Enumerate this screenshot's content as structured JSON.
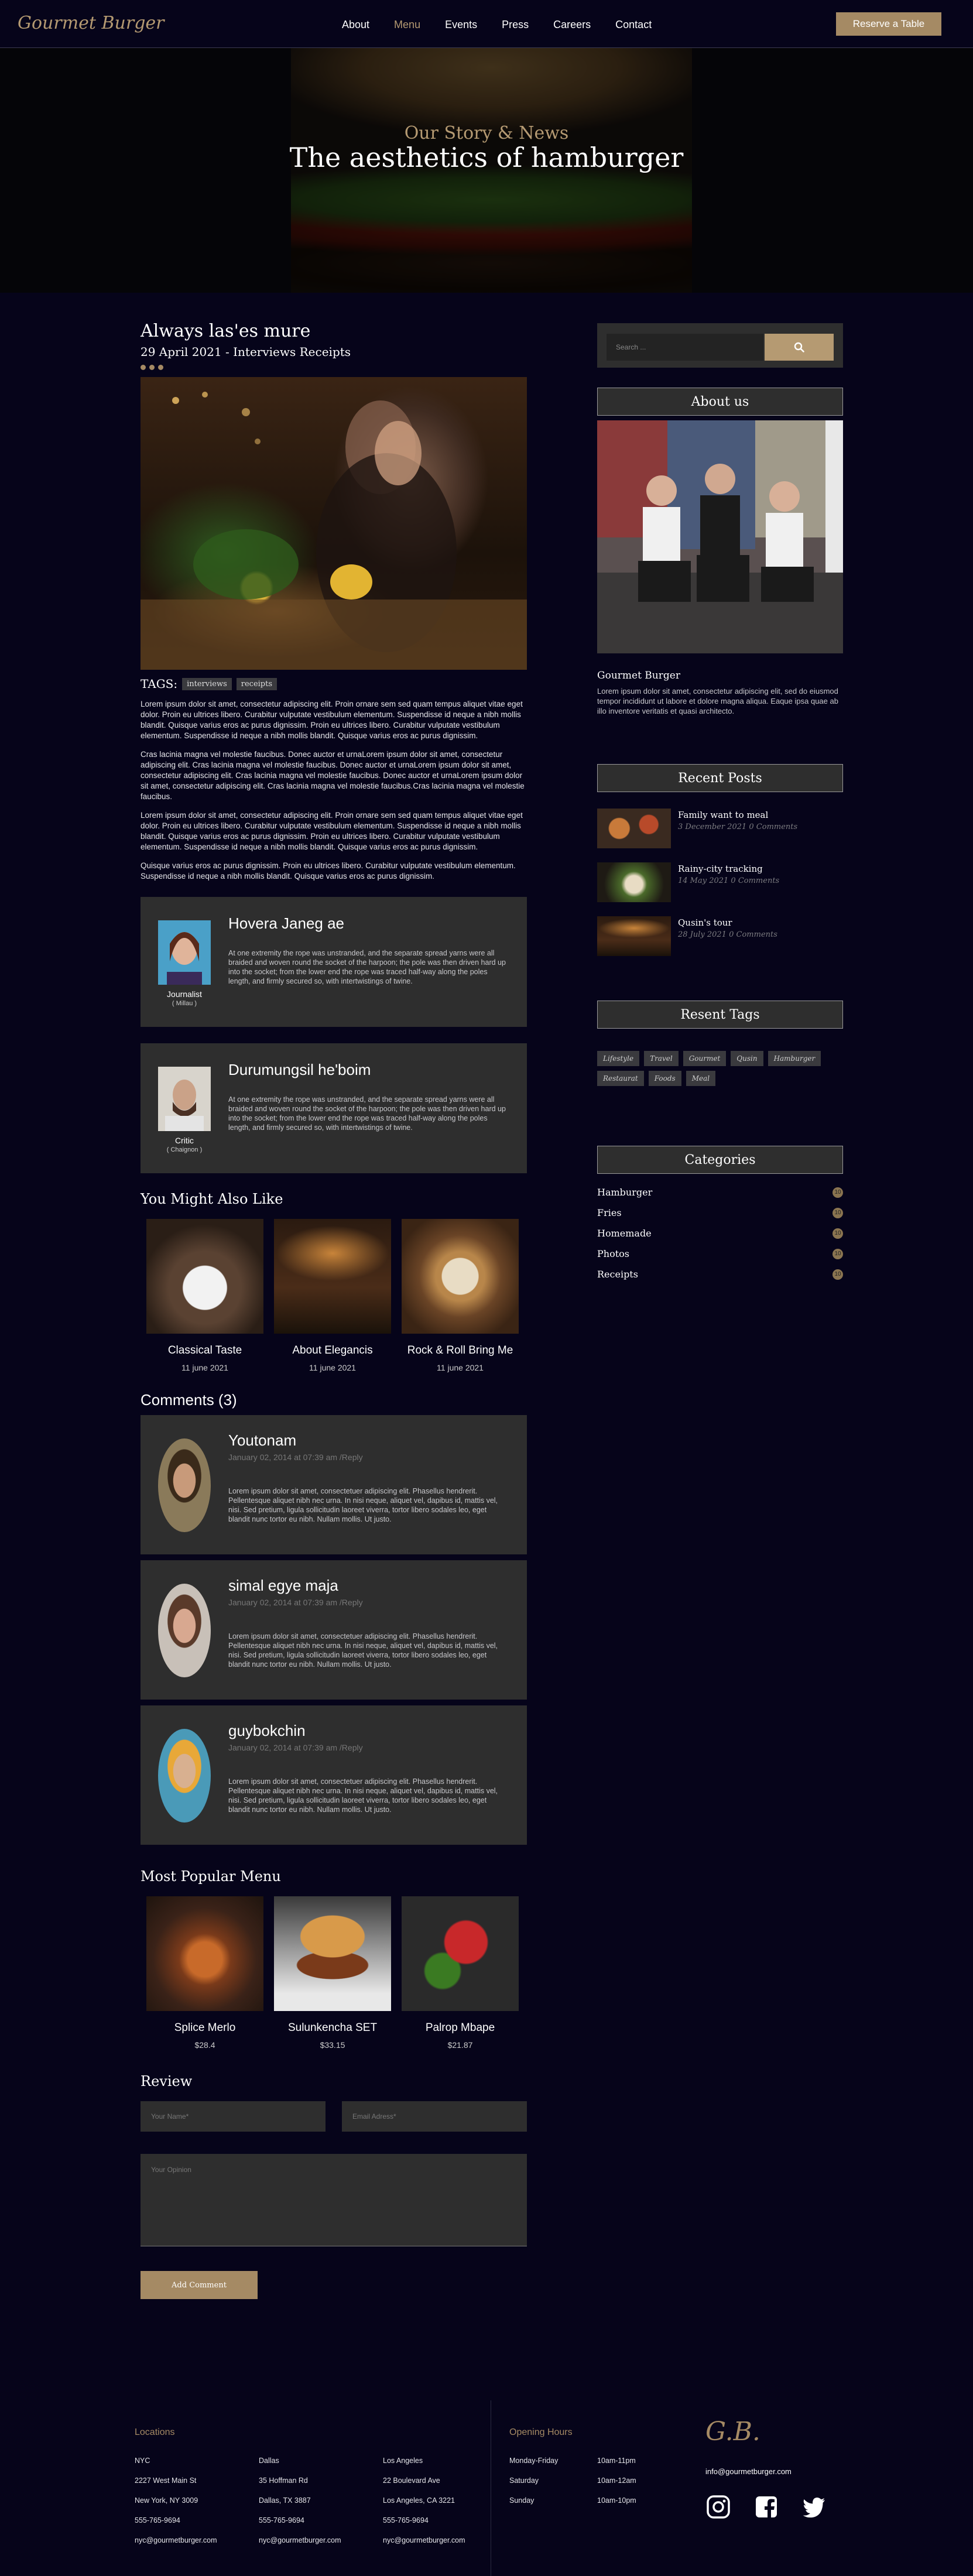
{
  "header": {
    "logo": "Gourmet Burger",
    "nav": [
      "About",
      "Menu",
      "Events",
      "Press",
      "Careers",
      "Contact"
    ],
    "active_nav": "Menu",
    "reserve_label": "Reserve a Table"
  },
  "hero": {
    "subtitle": "Our Story & News",
    "title": "The aesthetics of hamburger"
  },
  "post": {
    "title": "Always las'es mure",
    "meta": "29 April 2021 - Interviews Receipts",
    "tags_label": "TAGS:",
    "tags": [
      "interviews",
      "receipts"
    ],
    "paragraphs": [
      "Lorem ipsum dolor sit amet, consectetur adipiscing elit. Proin ornare sem sed quam tempus aliquet vitae eget dolor. Proin eu ultrices libero. Curabitur vulputate vestibulum elementum. Suspendisse id neque a nibh mollis blandit. Quisque varius eros ac purus dignissim. Proin eu ultrices libero. Curabitur vulputate vestibulum elementum. Suspendisse id neque a nibh mollis blandit. Quisque varius eros ac purus dignissim.",
      "Cras lacinia magna vel molestie faucibus. Donec auctor et urnaLorem ipsum dolor sit amet, consectetur adipiscing elit. Cras lacinia magna vel molestie faucibus. Donec auctor et urnaLorem ipsum dolor sit amet, consectetur adipiscing elit. Cras lacinia magna vel molestie faucibus. Donec auctor et urnaLorem ipsum dolor sit amet, consectetur adipiscing elit. Cras lacinia magna vel molestie faucibus.Cras lacinia magna vel molestie faucibus.",
      "Lorem ipsum dolor sit amet, consectetur adipiscing elit. Proin ornare sem sed quam tempus aliquet vitae eget dolor. Proin eu ultrices libero. Curabitur vulputate vestibulum elementum. Suspendisse id neque a nibh mollis blandit. Quisque varius eros ac purus dignissim. Proin eu ultrices libero. Curabitur vulputate vestibulum elementum. Suspendisse id neque a nibh mollis blandit. Quisque varius eros ac purus dignissim.",
      "Quisque varius eros ac purus dignissim. Proin eu ultrices libero. Curabitur vulputate vestibulum elementum. Suspendisse id neque a nibh mollis blandit. Quisque varius eros ac purus dignissim."
    ]
  },
  "authors": [
    {
      "name": "Hovera Janeg ae",
      "role": "Journalist",
      "location": "( Millau )",
      "bio": "At one extremity the rope was unstranded, and the separate spread yarns were all braided and woven round the socket of the harpoon; the pole was then driven hard up into the socket; from the lower end the rope was traced half-way along the poles length, and firmly secured so, with intertwistings of twine."
    },
    {
      "name": "Durumungsil he'boim",
      "role": "Critic",
      "location": "( Chaignon )",
      "bio": "At one extremity the rope was unstranded, and the separate spread yarns were all braided and woven round the socket of the harpoon; the pole was then driven hard up into the socket; from the lower end the rope was traced half-way along the poles length, and firmly secured so, with intertwistings of twine."
    }
  ],
  "also_like": {
    "heading": "You Might Also Like",
    "items": [
      {
        "name": "Classical Taste",
        "date": "11 june 2021"
      },
      {
        "name": "About Elegancis",
        "date": "11 june 2021"
      },
      {
        "name": "Rock & Roll Bring Me",
        "date": "11 june 2021"
      }
    ]
  },
  "comments": {
    "heading": "Comments (3)",
    "items": [
      {
        "name": "Youtonam",
        "date": "January 02, 2014 at 07:39 am /Reply",
        "text": "Lorem ipsum dolor sit amet, consectetuer adipiscing elit. Phasellus hendrerit. Pellentesque aliquet nibh nec urna. In nisi neque, aliquet vel, dapibus id, mattis vel, nisi. Sed pretium, ligula sollicitudin laoreet viverra, tortor libero sodales leo, eget blandit nunc tortor eu nibh. Nullam mollis. Ut justo."
      },
      {
        "name": "simal egye maja",
        "date": "January 02, 2014 at 07:39 am /Reply",
        "text": "Lorem ipsum dolor sit amet, consectetuer adipiscing elit. Phasellus hendrerit. Pellentesque aliquet nibh nec urna. In nisi neque, aliquet vel, dapibus id, mattis vel, nisi. Sed pretium, ligula sollicitudin laoreet viverra, tortor libero sodales leo, eget blandit nunc tortor eu nibh. Nullam mollis. Ut justo."
      },
      {
        "name": "guybokchin",
        "date": "January 02, 2014 at 07:39 am /Reply",
        "text": "Lorem ipsum dolor sit amet, consectetuer adipiscing elit. Phasellus hendrerit. Pellentesque aliquet nibh nec urna. In nisi neque, aliquet vel, dapibus id, mattis vel, nisi. Sed pretium, ligula sollicitudin laoreet viverra, tortor libero sodales leo, eget blandit nunc tortor eu nibh. Nullam mollis. Ut justo."
      }
    ]
  },
  "popular": {
    "heading": "Most Popular Menu",
    "items": [
      {
        "name": "Splice Merlo",
        "price": "$28.4"
      },
      {
        "name": "Sulunkencha SET",
        "price": "$33.15"
      },
      {
        "name": "Palrop Mbape",
        "price": "$21.87"
      }
    ]
  },
  "review": {
    "heading": "Review",
    "name_placeholder": "Your Name*",
    "email_placeholder": "Email Adress*",
    "opinion_placeholder": "Your Opinion",
    "submit_label": "Add Comment"
  },
  "sidebar": {
    "search_placeholder": "Search ...",
    "about_heading": "About us",
    "about_name": "Gourmet Burger",
    "about_text": "Lorem ipsum dolor sit amet, consectetur adipiscing elit, sed do eiusmod tempor incididunt ut labore et dolore magna aliqua. Eaque ipsa quae ab illo inventore veritatis et quasi architecto.",
    "recent_heading": "Recent Posts",
    "recent": [
      {
        "title": "Family want to meal",
        "meta": "3 December 2021 0 Comments"
      },
      {
        "title": "Rainy-city tracking",
        "meta": "14 May 2021 0 Comments"
      },
      {
        "title": "Qusin's tour",
        "meta": "28 July 2021 0 Comments"
      }
    ],
    "tags_heading": "Resent Tags",
    "tags": [
      "Lifestyle",
      "Travel",
      "Gourmet",
      "Qusin",
      "Hamburger",
      "Restaurat",
      "Foods",
      "Meal"
    ],
    "categories_heading": "Categories",
    "categories": [
      {
        "name": "Hamburger",
        "count": "10"
      },
      {
        "name": "Fries",
        "count": "10"
      },
      {
        "name": "Homemade",
        "count": "10"
      },
      {
        "name": "Photos",
        "count": "10"
      },
      {
        "name": "Receipts",
        "count": "10"
      }
    ]
  },
  "footer": {
    "locations_heading": "Locations",
    "locations": [
      {
        "city": "NYC",
        "address": "2227 West Main St",
        "region": "New York, NY 3009",
        "phone": "555-765-9694",
        "email": "nyc@gourmetburger.com"
      },
      {
        "city": "Dallas",
        "address": "35 Hoffman Rd",
        "region": "Dallas, TX 3887",
        "phone": "555-765-9694",
        "email": "nyc@gourmetburger.com"
      },
      {
        "city": "Los Angeles",
        "address": "22 Boulevard Ave",
        "region": "Los Angeles, CA 3221",
        "phone": "555-765-9694",
        "email": "nyc@gourmetburger.com"
      }
    ],
    "hours_heading": "Opening Hours",
    "hours": [
      {
        "day": "Monday-Friday",
        "time": "10am-11pm"
      },
      {
        "day": "Saturday",
        "time": "10am-12am"
      },
      {
        "day": "Sunday",
        "time": "10am-10pm"
      }
    ],
    "logo": "G.B.",
    "email": "info@gourmetburger.com",
    "social": [
      "instagram-icon",
      "facebook-icon",
      "twitter-icon"
    ]
  }
}
